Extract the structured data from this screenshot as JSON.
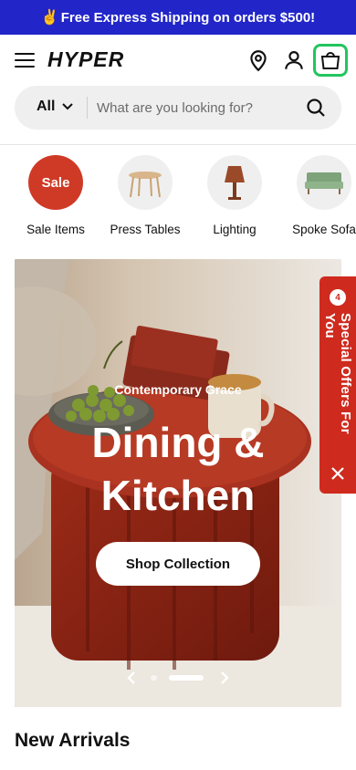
{
  "promo": {
    "emoji": "✌️",
    "text": "Free Express Shipping on orders $500!"
  },
  "header": {
    "logo": "HYPER"
  },
  "search": {
    "category": "All",
    "placeholder": "What are you looking for?"
  },
  "categories": [
    {
      "label": "Sale Items",
      "badge": "Sale"
    },
    {
      "label": "Press Tables"
    },
    {
      "label": "Lighting"
    },
    {
      "label": "Spoke Sofa"
    }
  ],
  "hero": {
    "eyebrow": "Contemporary Grace",
    "title": "Dining & Kitchen",
    "cta": "Shop Collection",
    "slides_total": 2,
    "active_slide": 2
  },
  "offers": {
    "count": "4",
    "label": "Special Offers For You"
  },
  "section": {
    "title": "New Arrivals"
  }
}
